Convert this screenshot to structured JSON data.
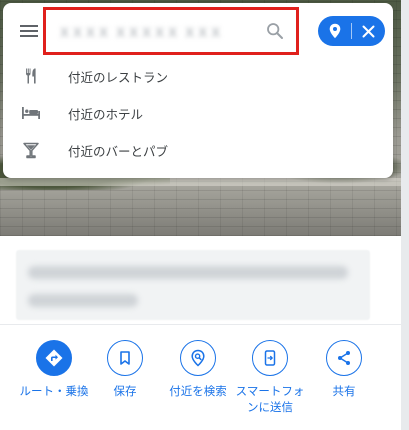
{
  "search": {
    "placeholder": "",
    "value": "ＸＸＸＸ ＸＸＸＸＸ ＸＸＸ"
  },
  "suggestions": [
    {
      "icon": "restaurant-icon",
      "label": "付近のレストラン"
    },
    {
      "icon": "hotel-icon",
      "label": "付近のホテル"
    },
    {
      "icon": "bar-icon",
      "label": "付近のバーとパブ"
    }
  ],
  "actions": [
    {
      "icon": "directions-icon",
      "label": "ルート・乗換",
      "primary": true
    },
    {
      "icon": "bookmark-icon",
      "label": "保存",
      "primary": false
    },
    {
      "icon": "nearby-search-icon",
      "label": "付近を検索",
      "primary": false
    },
    {
      "icon": "send-to-phone-icon",
      "label": "スマートフォンに送信",
      "primary": false
    },
    {
      "icon": "share-icon",
      "label": "共有",
      "primary": false
    }
  ],
  "colors": {
    "accent": "#1a73e8",
    "highlight_border": "#e0201c",
    "text": "#3c4043"
  }
}
